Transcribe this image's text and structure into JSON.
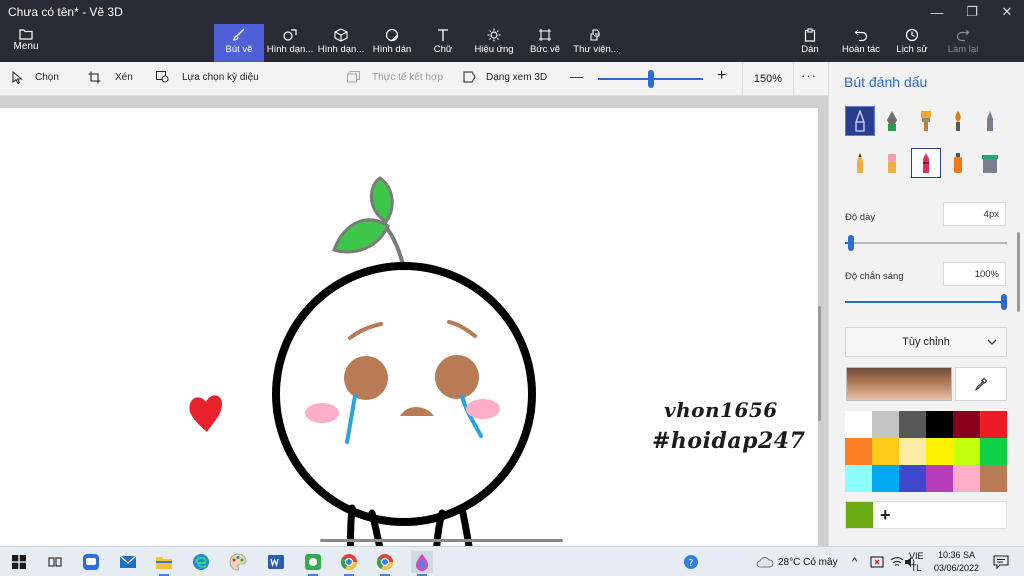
{
  "window": {
    "title": "Chưa có tên* - Vẽ 3D",
    "minimize": "—",
    "maximize": "❐",
    "close": "✕"
  },
  "ribbon": {
    "menu": "Menu",
    "tools": [
      {
        "label": "Bút vẽ",
        "icon": "brush-icon",
        "active": true
      },
      {
        "label": "Hình dạn...",
        "icon": "shapes-2d-icon"
      },
      {
        "label": "Hình dạn...",
        "icon": "shapes-3d-icon"
      },
      {
        "label": "Hình dán",
        "icon": "sticker-icon"
      },
      {
        "label": "Chữ",
        "icon": "text-icon"
      },
      {
        "label": "Hiệu ứng",
        "icon": "effects-icon"
      },
      {
        "label": "Bức vẽ",
        "icon": "canvas-icon"
      },
      {
        "label": "Thư viện...",
        "icon": "library-icon"
      }
    ],
    "right": [
      {
        "label": "Dán",
        "icon": "paste-icon"
      },
      {
        "label": "Hoàn tác",
        "icon": "undo-icon"
      },
      {
        "label": "Lịch sử",
        "icon": "history-icon"
      },
      {
        "label": "Làm lại",
        "icon": "redo-icon",
        "disabled": true
      }
    ]
  },
  "toolbar": {
    "select": "Chọn",
    "crop": "Xén",
    "magic_select": "Lựa chọn kỳ diệu",
    "mixed_reality": "Thực tế kết hợp",
    "view_3d": "Dạng xem 3D",
    "zoom_minus": "—",
    "zoom_plus": "+",
    "zoom": "150%",
    "more": "···",
    "zoom_level": 0.5
  },
  "canvas": {
    "sticker_line1": "vhon1656",
    "sticker_line2": "#hoidap247"
  },
  "panel": {
    "title": "Bút đánh dấu",
    "brushes": [
      "marker-icon",
      "calligraphy-pen-icon",
      "oil-brush-icon",
      "watercolor-icon",
      "pixel-pen-icon",
      "pencil-icon",
      "eraser-icon",
      "crayon-icon",
      "spray-can-icon",
      "fill-bucket-icon"
    ],
    "thickness_label": "Độ dày",
    "thickness_value": "4px",
    "thickness_level": 0.04,
    "opacity_label": "Độ chắn sáng",
    "opacity_value": "100%",
    "opacity_level": 1.0,
    "finish": "Tùy chỉnh",
    "current_color": "#b07a5a",
    "palette": [
      "#ffffff",
      "#c3c3c3",
      "#585858",
      "#000000",
      "#88001b",
      "#ec1c24",
      "#ff7f27",
      "#ffca18",
      "#fdeca6",
      "#fff200",
      "#c4ff0e",
      "#0ed145",
      "#8cfffb",
      "#00a8f3",
      "#3f48cc",
      "#b83dba",
      "#ffaec8",
      "#b97a56"
    ],
    "custom_color": "#6aaa12",
    "add": "+"
  },
  "taskbar": {
    "weather": "28°C  Có mây",
    "lang_top": "VIE",
    "lang_bottom": "TL",
    "time": "10:36 SA",
    "date": "03/06/2022"
  }
}
